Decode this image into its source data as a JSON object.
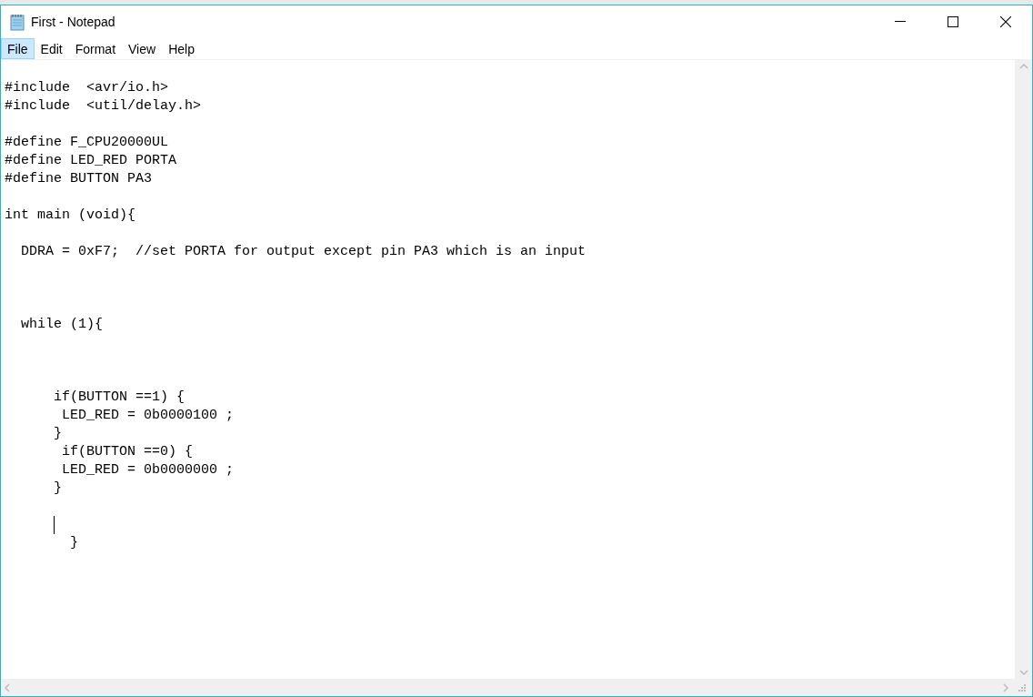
{
  "window": {
    "title": "First - Notepad"
  },
  "menu": [
    {
      "label": "File",
      "selected": true
    },
    {
      "label": "Edit",
      "selected": false
    },
    {
      "label": "Format",
      "selected": false
    },
    {
      "label": "View",
      "selected": false
    },
    {
      "label": "Help",
      "selected": false
    }
  ],
  "editor": {
    "text_before_caret": "#include  <avr/io.h>\n#include  <util/delay.h>\n\n#define F_CPU20000UL\n#define LED_RED PORTA\n#define BUTTON PA3\n\nint main (void){\n\n  DDRA = 0xF7;  //set PORTA for output except pin PA3 which is an input\n\n\n\n  while (1){\n\n\n\n      if(BUTTON ==1) {\n       LED_RED = 0b0000100 ;\n      }\n       if(BUTTON ==0) {\n       LED_RED = 0b0000000 ;\n      }\n\n      ",
    "text_after_caret": "\n        }"
  }
}
